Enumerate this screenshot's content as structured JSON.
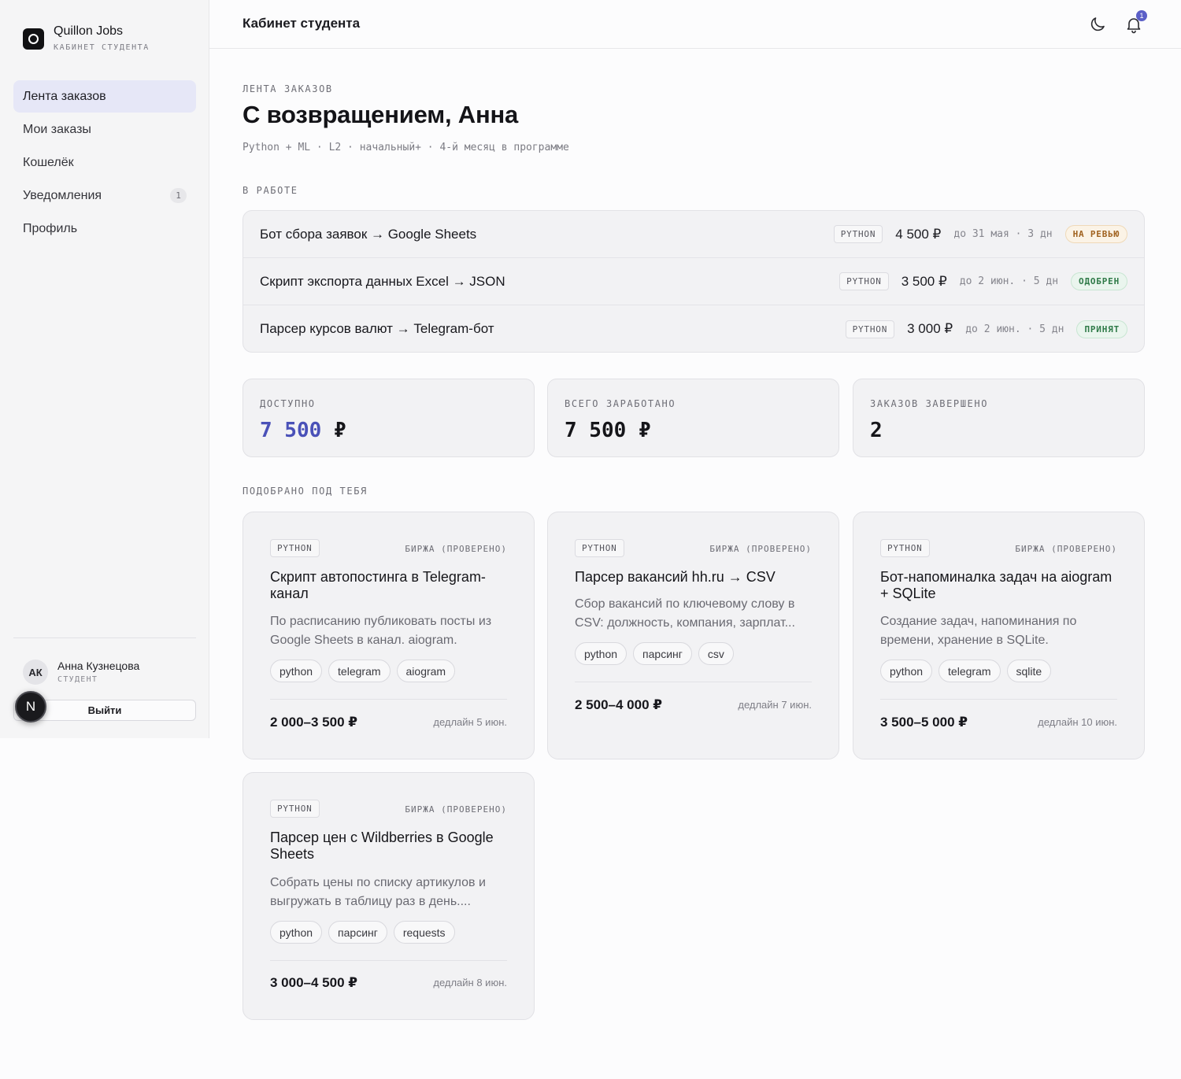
{
  "sidebar": {
    "brand_name": "Quillon Jobs",
    "brand_sub": "КАБИНЕТ СТУДЕНТА",
    "items": [
      {
        "label": "Лента заказов",
        "active": true
      },
      {
        "label": "Мои заказы"
      },
      {
        "label": "Кошелёк"
      },
      {
        "label": "Уведомления",
        "badge": "1"
      },
      {
        "label": "Профиль"
      }
    ],
    "user": {
      "initials": "АК",
      "name": "Анна Кузнецова",
      "role": "СТУДЕНТ"
    },
    "logout_label": "Выйти",
    "fab_letter": "N"
  },
  "header": {
    "title": "Кабинет студента",
    "notification_count": "1"
  },
  "welcome": {
    "eyebrow": "ЛЕНТА ЗАКАЗОВ",
    "title": "С возвращением, Анна",
    "meta": "Python + ML · L2 · начальный+ · 4-й месяц в программе"
  },
  "in_progress": {
    "label": "В РАБОТЕ",
    "orders": [
      {
        "title": "Бот сбора заявок → Google Sheets",
        "lang": "PYTHON",
        "price": "4 500 ₽",
        "deadline": "до 31 мая · 3 дн",
        "status": "НА РЕВЬЮ"
      },
      {
        "title": "Скрипт экспорта данных Excel → JSON",
        "lang": "PYTHON",
        "price": "3 500 ₽",
        "deadline": "до 2 июн. · 5 дн",
        "status": "ОДОБРЕН"
      },
      {
        "title": "Парсер курсов валют → Telegram-бот",
        "lang": "PYTHON",
        "price": "3 000 ₽",
        "deadline": "до 2 июн. · 5 дн",
        "status": "ПРИНЯТ"
      }
    ]
  },
  "stats": [
    {
      "label": "ДОСТУПНО",
      "number": "7 500",
      "currency": "₽"
    },
    {
      "label": "ВСЕГО ЗАРАБОТАНО",
      "number": "7 500",
      "currency": "₽"
    },
    {
      "label": "ЗАКАЗОВ ЗАВЕРШЕНО",
      "number": "2",
      "currency": ""
    }
  ],
  "recommended": {
    "label": "ПОДОБРАНО ПОД ТЕБЯ",
    "jobs": [
      {
        "lang": "PYTHON",
        "source": "БИРЖА (ПРОВЕРЕНО)",
        "title": "Скрипт автопостинга в Telegram-канал",
        "desc": "По расписанию публиковать посты из Google Sheets в канал. aiogram.",
        "tags": [
          "python",
          "telegram",
          "aiogram"
        ],
        "price": "2 000–3 500 ₽",
        "deadline": "дедлайн 5 июн."
      },
      {
        "lang": "PYTHON",
        "source": "БИРЖА (ПРОВЕРЕНО)",
        "title": "Парсер вакансий hh.ru → CSV",
        "desc": "Сбор вакансий по ключевому слову в CSV: должность, компания, зарплат...",
        "tags": [
          "python",
          "парсинг",
          "csv"
        ],
        "price": "2 500–4 000 ₽",
        "deadline": "дедлайн 7 июн."
      },
      {
        "lang": "PYTHON",
        "source": "БИРЖА (ПРОВЕРЕНО)",
        "title": "Бот-напоминалка задач на aiogram + SQLite",
        "desc": "Создание задач, напоминания по времени, хранение в SQLite.",
        "tags": [
          "python",
          "telegram",
          "sqlite"
        ],
        "price": "3 500–5 000 ₽",
        "deadline": "дедлайн 10 июн."
      },
      {
        "lang": "PYTHON",
        "source": "БИРЖА (ПРОВЕРЕНО)",
        "title": "Парсер цен с Wildberries в Google Sheets",
        "desc": "Собрать цены по списку артикулов и выгружать в таблицу раз в день....",
        "tags": [
          "python",
          "парсинг",
          "requests"
        ],
        "price": "3 000–4 500 ₽",
        "deadline": "дедлайн 8 июн."
      }
    ]
  },
  "colors": {
    "accent": "#5b5fc7",
    "stat_accent": "#4a51b8",
    "review": "#a0621f",
    "approved": "#2f7a48"
  }
}
